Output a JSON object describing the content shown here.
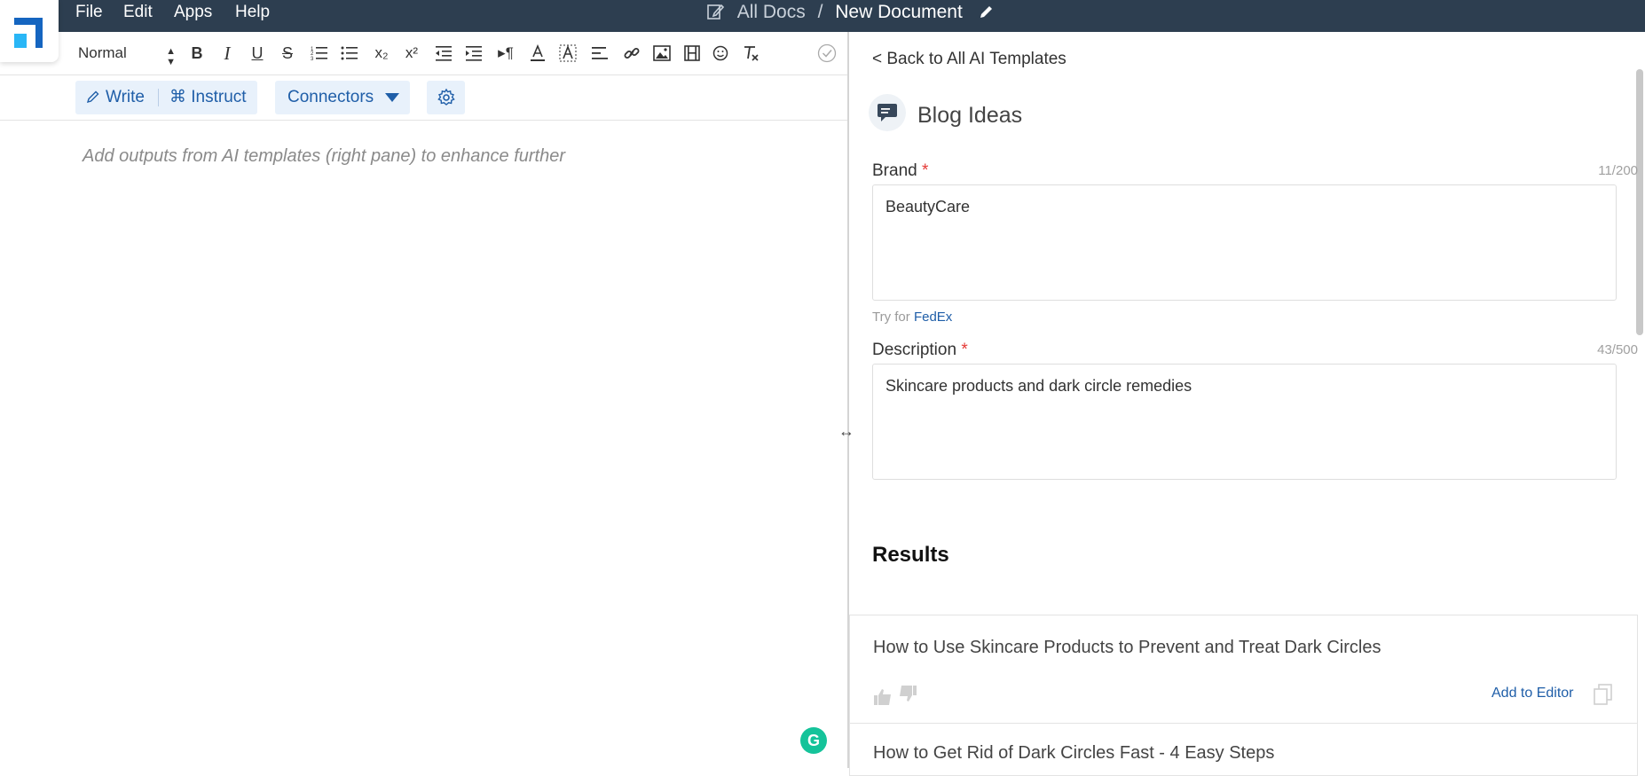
{
  "menu": {
    "file": "File",
    "edit": "Edit",
    "apps": "Apps",
    "help": "Help"
  },
  "breadcrumb": {
    "root": "All Docs",
    "separator": "/",
    "current": "New Document"
  },
  "toolbar": {
    "style_select": "Normal",
    "bold": "B",
    "italic": "I",
    "underline": "U",
    "strike": "S",
    "subscript": "x₂",
    "superscript": "x²"
  },
  "modes": {
    "write": "Write",
    "instruct": "⌘ Instruct",
    "connectors": "Connectors"
  },
  "editor": {
    "placeholder": "Add outputs from AI templates (right pane) to enhance further"
  },
  "panel": {
    "back": "< Back to All AI Templates",
    "title": "Blog Ideas",
    "brand_label": "Brand",
    "brand_counter": "11/200",
    "brand_value": "BeautyCare",
    "try_for": "Try for",
    "try_link": "FedEx",
    "desc_label": "Description",
    "desc_counter": "43/500",
    "desc_value": "Skincare products and dark circle remedies",
    "results_heading": "Results",
    "results": [
      {
        "text": "How to Use Skincare Products to Prevent and Treat Dark Circles",
        "add": "Add to Editor"
      },
      {
        "text": "How to Get Rid of Dark Circles Fast - 4 Easy Steps"
      }
    ]
  },
  "colors": {
    "topbar": "#2d3e50",
    "accent": "#1f5ea8",
    "required": "#e53935"
  }
}
